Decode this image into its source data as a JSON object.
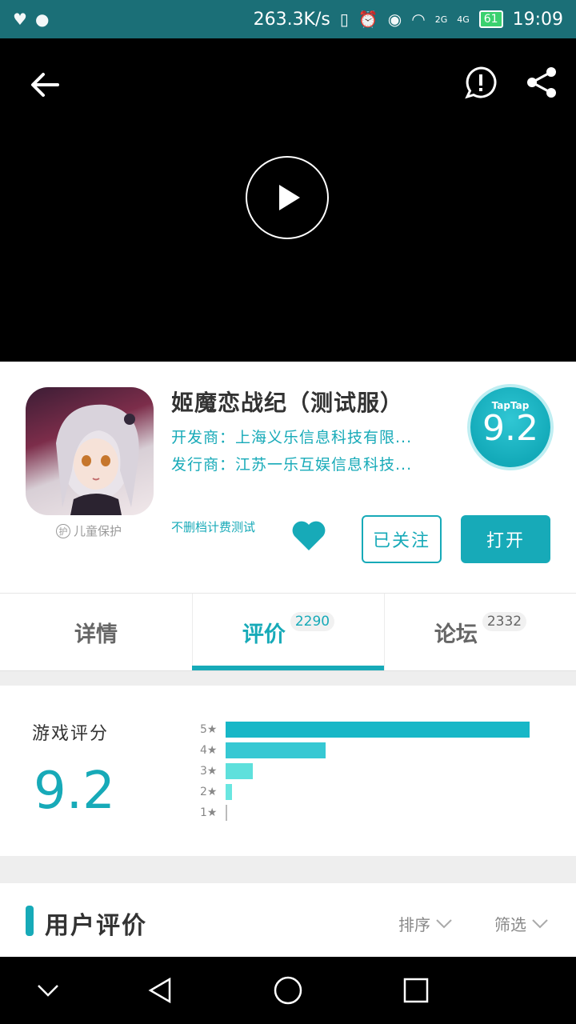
{
  "status_bar": {
    "speed": "263.3K/s",
    "battery": "61",
    "time": "19:09",
    "network_2g": "2G",
    "network_4g": "4G"
  },
  "app": {
    "title": "姬魔恋战纪（测试服）",
    "developer": "开发商：上海义乐信息科技有限...",
    "publisher": "发行商：江苏一乐互娱信息科技...",
    "child_protect_mark": "护",
    "child_protect": "儿童保护",
    "test_note": "不删档计费测试",
    "score_brand": "TapTap",
    "score": "9.2",
    "follow_label": "已关注",
    "open_label": "打开"
  },
  "tabs": [
    {
      "label": "详情",
      "count": ""
    },
    {
      "label": "评价",
      "count": "2290"
    },
    {
      "label": "论坛",
      "count": "2332"
    }
  ],
  "rating": {
    "label": "游戏评分",
    "score": "9.2",
    "distribution": [
      {
        "star": "5★",
        "fraction": 1.0,
        "color": "#17b7c7"
      },
      {
        "star": "4★",
        "fraction": 0.33,
        "color": "#36c8d3"
      },
      {
        "star": "3★",
        "fraction": 0.09,
        "color": "#5ee0dc"
      },
      {
        "star": "2★",
        "fraction": 0.02,
        "color": "#6ae6e0"
      },
      {
        "star": "1★",
        "fraction": 0.006,
        "color": "#bbbbbb"
      }
    ]
  },
  "reviews": {
    "title": "用户评价",
    "sort_label": "排序",
    "filter_label": "筛选"
  }
}
